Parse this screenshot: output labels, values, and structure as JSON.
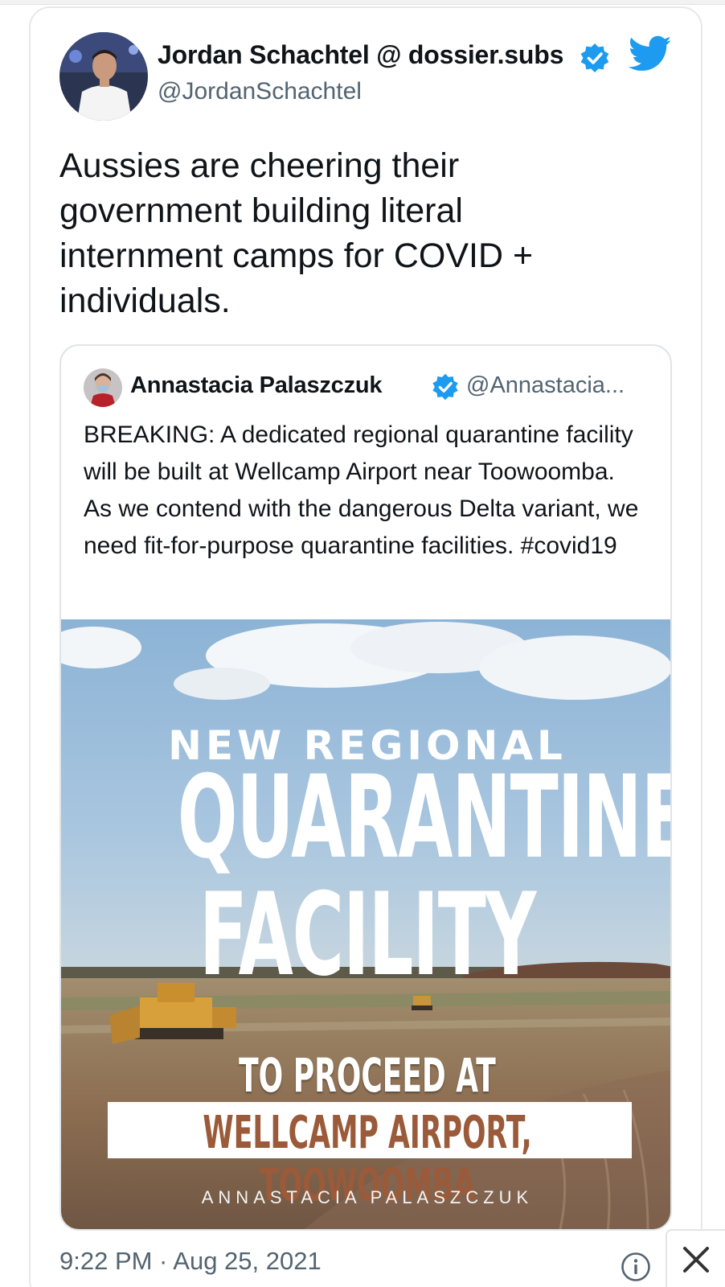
{
  "tweet": {
    "author_name": "Jordan Schachtel @ dossier.subs",
    "author_handle": "@JordanSchachtel",
    "text": "Aussies are cheering their government building literal internment camps for COVID + individuals.",
    "timestamp": "9:22 PM · Aug 25, 2021"
  },
  "quoted_tweet": {
    "author_name": "Annastacia Palaszczuk",
    "author_handle": "@Annastacia...",
    "text": "BREAKING: A dedicated regional quarantine facility will be built at Wellcamp Airport near Toowoomba. As we contend with the dangerous Delta variant, we need fit-for-purpose quarantine facilities. #covid19",
    "image": {
      "line1": "NEW REGIONAL",
      "line2": "QUARANTINE",
      "line3": "FACILITY",
      "line4": "TO PROCEED AT",
      "line5": "WELLCAMP AIRPORT, TOOWOOMBA",
      "line6": "ANNASTACIA PALASZCZUK"
    }
  },
  "icons": {
    "verified": "verified-badge-icon",
    "twitter": "twitter-bird-icon",
    "info": "info-icon",
    "close": "close-icon"
  },
  "colors": {
    "twitter_blue": "#1d9bf0",
    "text": "#0f1419",
    "secondary_text": "#536471",
    "banner_text": "#9b5a39"
  }
}
